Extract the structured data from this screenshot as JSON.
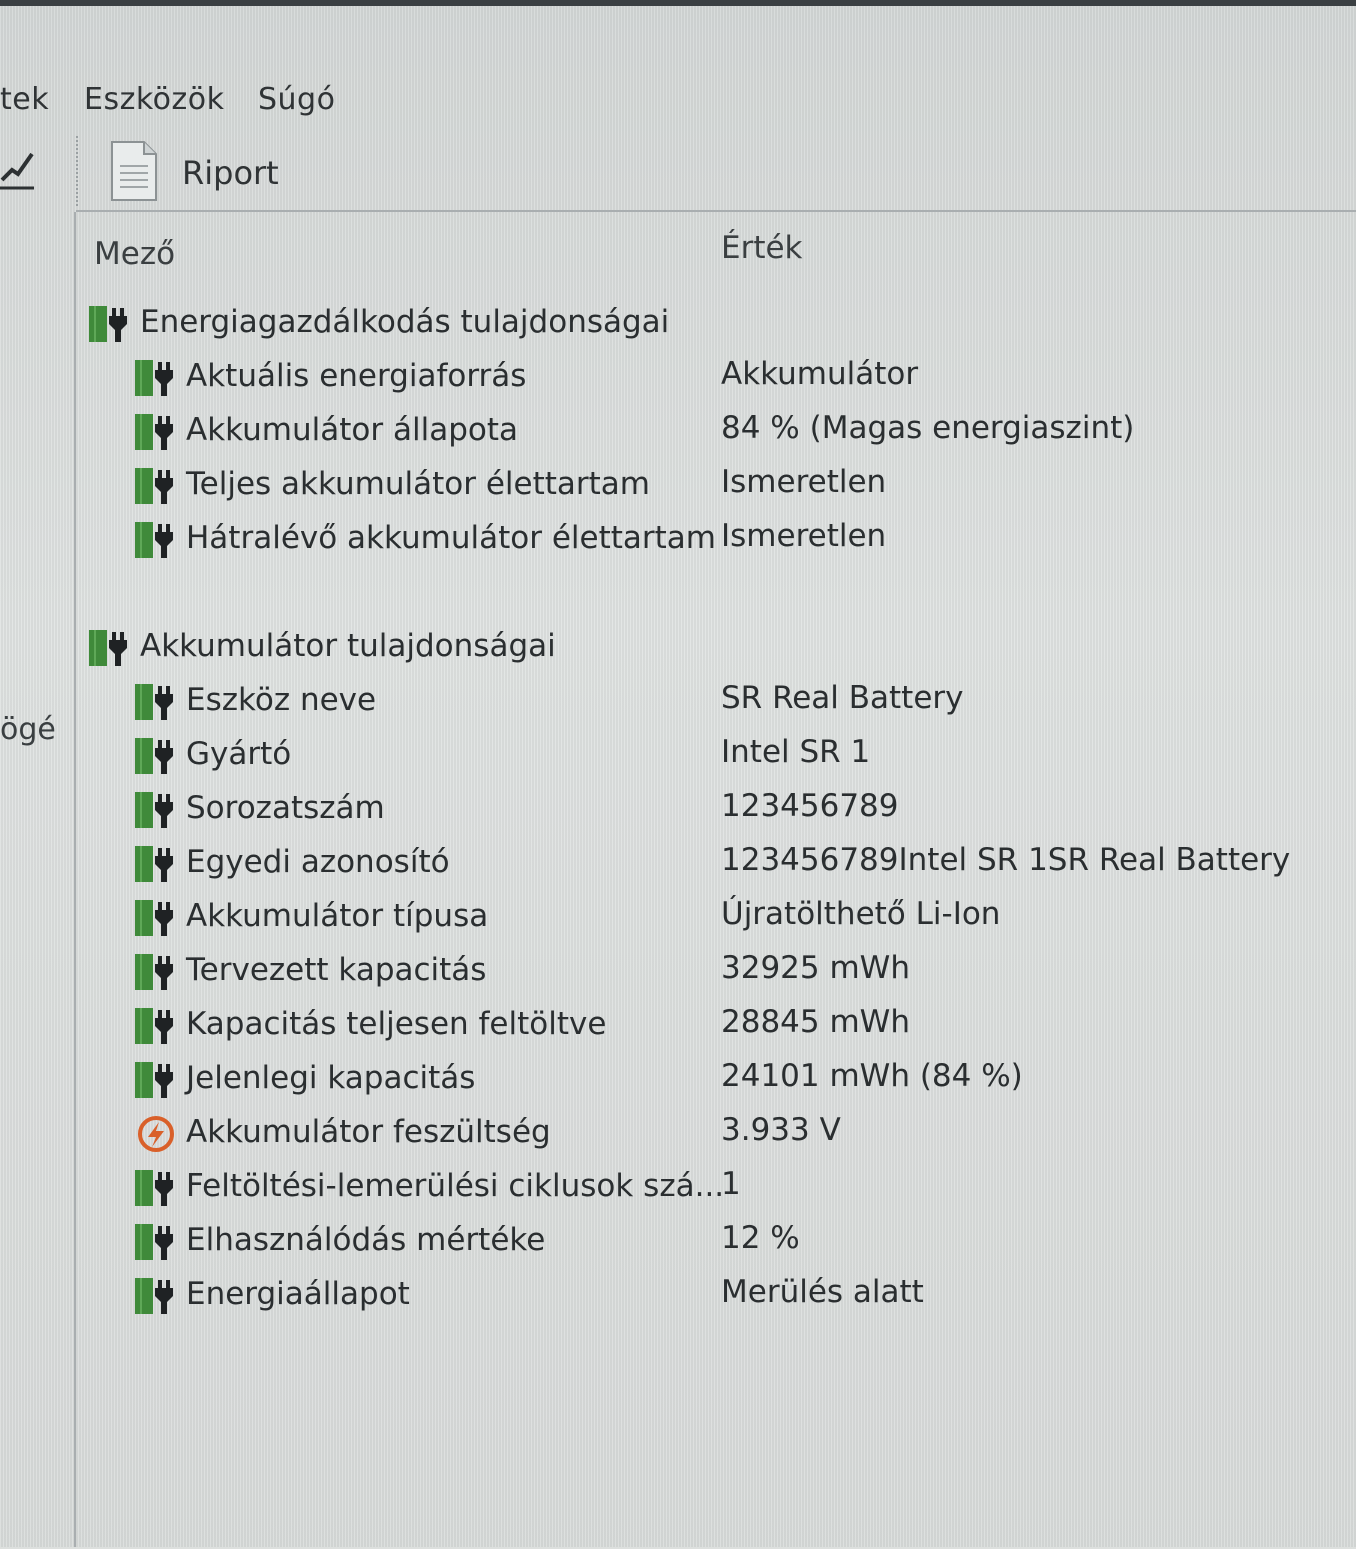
{
  "menu": {
    "items": [
      "tek",
      "Eszközök",
      "Súgó"
    ]
  },
  "toolbar": {
    "report_label": "Riport"
  },
  "left_pane": {
    "cut_text": "ögé"
  },
  "table": {
    "columns": [
      "Mező",
      "Érték"
    ],
    "groups": [
      {
        "title": "Energiagazdálkodás tulajdonságai",
        "rows": [
          {
            "field": "Aktuális energiaforrás",
            "value": "Akkumulátor",
            "icon": "battery-plug-icon"
          },
          {
            "field": "Akkumulátor állapota",
            "value": "84 % (Magas energiaszint)",
            "icon": "battery-plug-icon"
          },
          {
            "field": "Teljes akkumulátor élettartam",
            "value": "Ismeretlen",
            "icon": "battery-plug-icon"
          },
          {
            "field": "Hátralévő akkumulátor élettartam",
            "value": "Ismeretlen",
            "icon": "battery-plug-icon"
          }
        ]
      },
      {
        "title": "Akkumulátor tulajdonságai",
        "rows": [
          {
            "field": "Eszköz neve",
            "value": "SR Real Battery",
            "icon": "battery-plug-icon"
          },
          {
            "field": "Gyártó",
            "value": "Intel SR 1",
            "icon": "battery-plug-icon"
          },
          {
            "field": "Sorozatszám",
            "value": "123456789",
            "icon": "battery-plug-icon"
          },
          {
            "field": "Egyedi azonosító",
            "value": "123456789Intel SR 1SR Real Battery",
            "icon": "battery-plug-icon"
          },
          {
            "field": "Akkumulátor típusa",
            "value": "Újratölthető Li-Ion",
            "icon": "battery-plug-icon"
          },
          {
            "field": "Tervezett kapacitás",
            "value": "32925 mWh",
            "icon": "battery-plug-icon"
          },
          {
            "field": "Kapacitás teljesen feltöltve",
            "value": "28845 mWh",
            "icon": "battery-plug-icon"
          },
          {
            "field": "Jelenlegi kapacitás",
            "value": "24101 mWh  (84 %)",
            "icon": "battery-plug-icon"
          },
          {
            "field": "Akkumulátor feszültség",
            "value": "3.933 V",
            "icon": "voltage-icon"
          },
          {
            "field": "Feltöltési-lemerülési ciklusok szá...",
            "value": "1",
            "icon": "battery-plug-icon"
          },
          {
            "field": "Elhasználódás mértéke",
            "value": "12 %",
            "icon": "battery-plug-icon"
          },
          {
            "field": "Energiaállapot",
            "value": "Merülés alatt",
            "icon": "battery-plug-icon"
          }
        ]
      }
    ]
  },
  "colors": {
    "battery_green": "#3f8a3a",
    "plug_dark": "#1f2224",
    "voltage_orange": "#d9602a"
  }
}
